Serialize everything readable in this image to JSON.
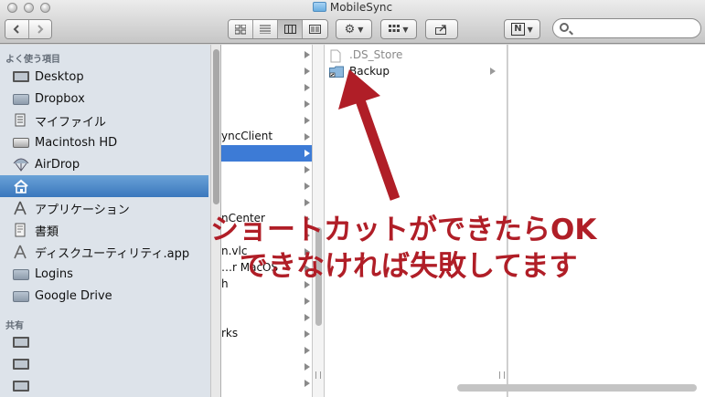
{
  "window": {
    "title": "MobileSync"
  },
  "toolbar": {
    "back_icon": "chevron-left-icon",
    "forward_icon": "chevron-right-icon",
    "view_modes": [
      "icon-view",
      "list-view",
      "column-view",
      "coverflow-view"
    ],
    "active_view": "column-view",
    "action_icon": "gear-icon",
    "arrange_icon": "grid-icon",
    "share_icon": "share-icon",
    "n_button": "N",
    "search_placeholder": ""
  },
  "sidebar": {
    "favorites_header": "よく使う項目",
    "items": [
      {
        "label": "Desktop",
        "icon": "desktop-icon"
      },
      {
        "label": "Dropbox",
        "icon": "folder-icon"
      },
      {
        "label": "マイファイル",
        "icon": "all-files-icon"
      },
      {
        "label": "Macintosh HD",
        "icon": "hard-drive-icon"
      },
      {
        "label": "AirDrop",
        "icon": "airdrop-icon"
      },
      {
        "label": "",
        "icon": "home-icon",
        "selected": true
      },
      {
        "label": "アプリケーション",
        "icon": "applications-icon"
      },
      {
        "label": "書類",
        "icon": "documents-icon"
      },
      {
        "label": "ディスクユーティリティ.app",
        "icon": "disk-utility-icon"
      },
      {
        "label": "Logins",
        "icon": "folder-icon"
      },
      {
        "label": "Google Drive",
        "icon": "folder-icon"
      }
    ],
    "shared_header": "共有",
    "shared_items": [
      {
        "label": "",
        "icon": "computer-icon"
      },
      {
        "label": "",
        "icon": "computer-icon"
      },
      {
        "label": "",
        "icon": "computer-icon"
      }
    ]
  },
  "column2": {
    "rows": [
      {
        "text": "",
        "arrow": true
      },
      {
        "text": "",
        "arrow": true
      },
      {
        "text": "",
        "arrow": true
      },
      {
        "text": "",
        "arrow": true
      },
      {
        "text": "",
        "arrow": true
      },
      {
        "text": "yncClient",
        "arrow": true
      },
      {
        "text": "",
        "arrow": true,
        "selected": true
      },
      {
        "text": "",
        "arrow": true
      },
      {
        "text": "",
        "arrow": true
      },
      {
        "text": "",
        "arrow": true
      },
      {
        "text": "nCenter",
        "arrow": true
      },
      {
        "text": "",
        "arrow": true
      },
      {
        "text": "n.vlc",
        "arrow": true
      },
      {
        "text": "…r MacOS",
        "arrow": true
      },
      {
        "text": "h",
        "arrow": true
      },
      {
        "text": "",
        "arrow": true
      },
      {
        "text": "",
        "arrow": true
      },
      {
        "text": "rks",
        "arrow": true
      },
      {
        "text": "",
        "arrow": true
      },
      {
        "text": "",
        "arrow": true
      },
      {
        "text": "",
        "arrow": true
      }
    ]
  },
  "column3": {
    "files": [
      {
        "name": ".DS_Store",
        "icon": "document-icon",
        "dimmed": true,
        "arrow": false
      },
      {
        "name": "Backup",
        "icon": "alias-folder-icon",
        "dimmed": false,
        "arrow": true
      }
    ]
  },
  "annotation": {
    "line1": "ショートカットができたらOK",
    "line2": "できなければ失敗してます",
    "color": "#b01e27"
  }
}
